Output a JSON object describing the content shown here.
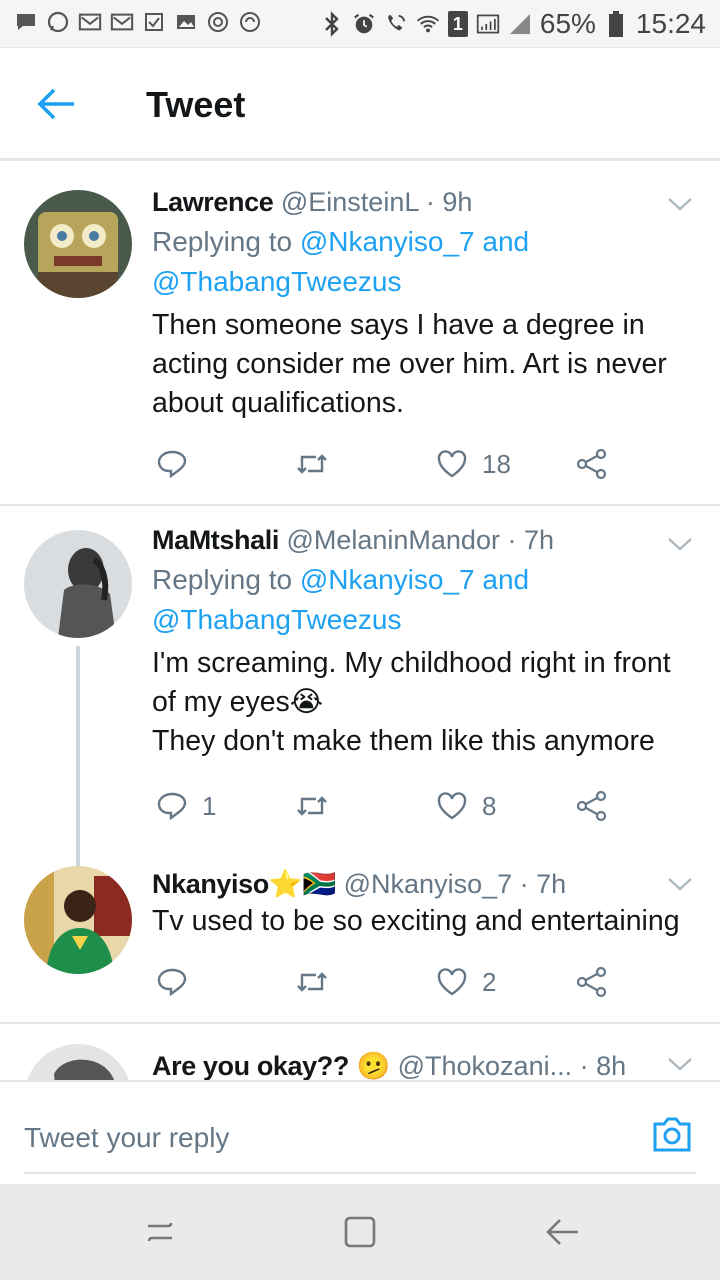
{
  "status_bar": {
    "battery_percent": "65%",
    "time": "15:24",
    "left_icons": [
      "chat-bubble-icon",
      "whatsapp-icon",
      "gmail-icon",
      "gmail-icon",
      "checkbox-icon",
      "image-icon",
      "sync-icon",
      "sync-icon"
    ],
    "right_icons": [
      "bluetooth-icon",
      "alarm-icon",
      "wifi-call-icon",
      "wifi-icon",
      "sim-1-icon",
      "signal-icon",
      "signal-icon",
      "battery-icon"
    ],
    "sim_label": "1"
  },
  "header": {
    "title": "Tweet",
    "accent_color": "#1da1f2"
  },
  "tweets": [
    {
      "name": "Lawrence",
      "handle": "@EinsteinL",
      "time": "· 9h",
      "replying_prefix": "Replying to",
      "reply_target_1": "@Nkanyiso_7",
      "reply_and": "and",
      "reply_target_2": "@ThabangTweezus",
      "text_lines": [
        "Then someone says I have a degree in",
        "acting consider me over him. Art is never",
        "about qualifications."
      ],
      "replies": "",
      "likes": "18"
    },
    {
      "name": "MaMtshali",
      "handle": "@MelaninMandor",
      "time": "· 7h",
      "replying_prefix": "Replying to",
      "reply_target_1": "@Nkanyiso_7",
      "reply_and": "and",
      "reply_target_2": "@ThabangTweezus",
      "text_lines": [
        "I'm screaming. My childhood right in front",
        "of my eyes😭",
        "They don't make them like this anymore"
      ],
      "replies": "1",
      "likes": "8"
    },
    {
      "name": "Nkanyiso",
      "name_emoji": "⭐🇿🇦",
      "handle": "@Nkanyiso_7",
      "time": "· 7h",
      "text_lines": [
        "Tv used to be so exciting and entertaining"
      ],
      "replies": "",
      "likes": "2"
    },
    {
      "name": "Are you okay??",
      "name_emoji": "🫤",
      "handle": "@Thokozani...",
      "time": "· 8h"
    }
  ],
  "reply_bar": {
    "placeholder": "Tweet your reply"
  }
}
